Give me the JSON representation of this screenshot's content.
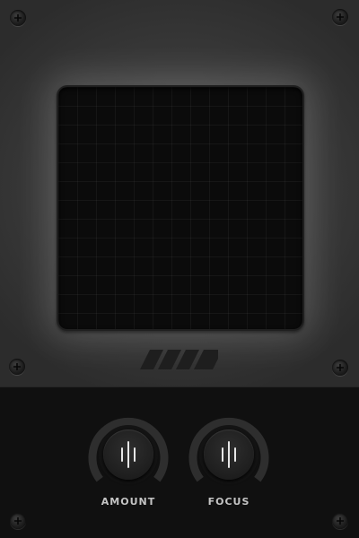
{
  "colors": {
    "panel": "#3a3a3a",
    "screen": "#0b0b0b",
    "base": "#101010",
    "label": "#c4c4c4",
    "knob_arc": "#2e2e2e"
  },
  "logo": {
    "icon": "stripes-logo-icon"
  },
  "controls": {
    "amount": {
      "label": "AMOUNT",
      "icon": "bars-icon"
    },
    "focus": {
      "label": "FOCUS",
      "icon": "bars-icon"
    }
  }
}
